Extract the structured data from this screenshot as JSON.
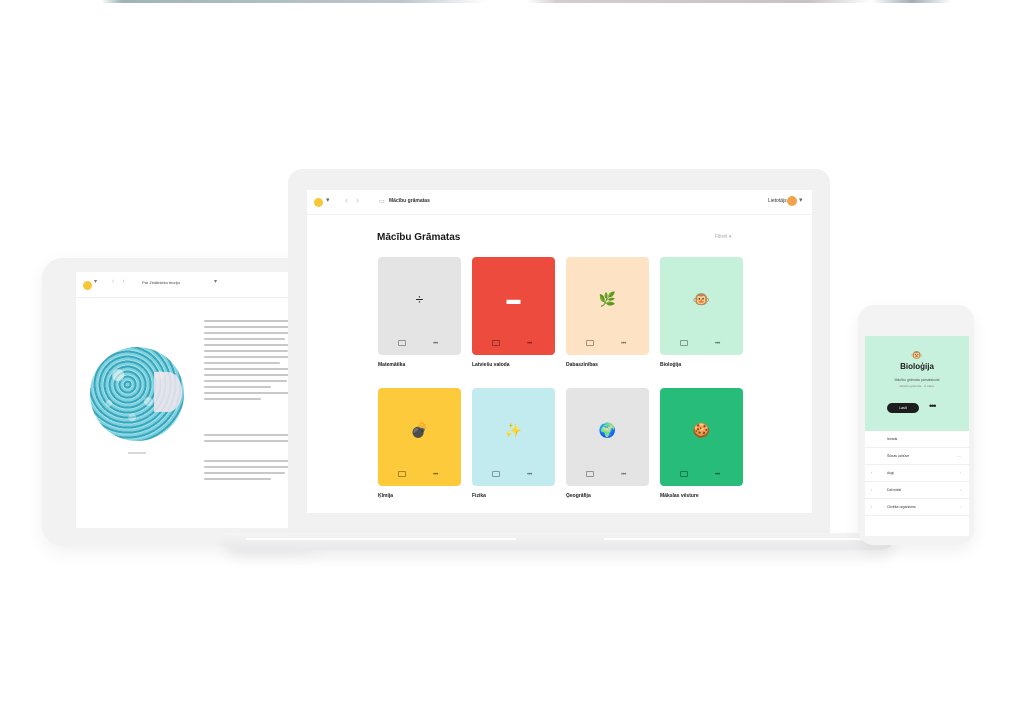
{
  "tablet": {
    "breadcrumb": "Par Zinātnieku teoriju",
    "text_lines_a": [
      1,
      0.9,
      0.95,
      0.85,
      0.92,
      0.88,
      0.96,
      0.8,
      0.9,
      0.93,
      0.87,
      0.7,
      0.94,
      0.6
    ],
    "text_lines_b": [
      0.95,
      0.9
    ],
    "text_lines_c": [
      0.9,
      0.95,
      0.85,
      0.7
    ]
  },
  "laptop": {
    "breadcrumb": "Mācību grāmatas",
    "user_label": "Lietotājs",
    "page_title": "Mācību Grāmatas",
    "filter_label": "Filtrēt",
    "cards": [
      {
        "label": "Matemātika",
        "icon": "÷",
        "color": "#e4e4e5",
        "icon_color": "#222"
      },
      {
        "label": "Latviešu valoda",
        "icon": "▬",
        "color": "#ee4b3f",
        "icon_color": "#fff"
      },
      {
        "label": "Dabaszinības",
        "icon": "🌿",
        "color": "#fde2c4",
        "icon_color": "#6a8f2a"
      },
      {
        "label": "Bioloģija",
        "icon": "🐵",
        "color": "#c5f0da",
        "icon_color": "#8a5a2b"
      },
      {
        "label": "Ķīmija",
        "icon": "💣",
        "color": "#fdca3b",
        "icon_color": "#222"
      },
      {
        "label": "Fizika",
        "icon": "✨",
        "color": "#c2ebef",
        "icon_color": "#d9b13a"
      },
      {
        "label": "Ģeogrāfija",
        "icon": "🌍",
        "color": "#e4e4e5",
        "icon_color": "#2a7a3a"
      },
      {
        "label": "Mākslas vēsture",
        "icon": "🍪",
        "color": "#27bc79",
        "icon_color": "#b07a3e"
      }
    ]
  },
  "phone": {
    "emoji": "🐵",
    "title": "Bioloģija",
    "subtitle": "Mācību grāmata pamatskolai",
    "subtitle2": "Mācību grāmata · 9. klase",
    "open_label": "Lasīt",
    "more_label": "•••",
    "rows": [
      {
        "label": "Ievads",
        "arrow": "",
        "right": ""
      },
      {
        "label": "Šūnas uzbūve",
        "arrow": "",
        "right": "—"
      },
      {
        "label": "Augi",
        "arrow": "›",
        "right": "›"
      },
      {
        "label": "Dzīvnieki",
        "arrow": "›",
        "right": "›"
      },
      {
        "label": "Cilvēka organisms",
        "arrow": "›",
        "right": "›"
      }
    ]
  }
}
